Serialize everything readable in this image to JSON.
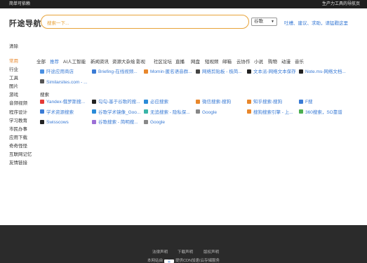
{
  "topbar": {
    "left_text": "简单可依赖",
    "right_text": "生产力工具的导航页"
  },
  "header": {
    "logo": "阡途导航",
    "search_placeholder": "搜索一下...",
    "engine": "谷歌",
    "feedback_link": "吐槽、建议、求助，请猛戳这里"
  },
  "clear_label": "清除",
  "sidebar": {
    "items": [
      {
        "label": "常用",
        "active": true
      },
      {
        "label": "行业"
      },
      {
        "label": "工具"
      },
      {
        "label": "图片"
      },
      {
        "label": "游戏"
      },
      {
        "label": "音频视频"
      },
      {
        "label": "程序设计"
      },
      {
        "label": "学习教育"
      },
      {
        "label": "市民办事"
      },
      {
        "label": "应用下载"
      },
      {
        "label": "奇奇怪怪"
      },
      {
        "label": "互联网记忆"
      },
      {
        "label": "友情链接"
      }
    ]
  },
  "tabs": [
    {
      "label": "全部"
    },
    {
      "label": "推荐",
      "active": true
    },
    {
      "label": "AI人工智能"
    },
    {
      "label": "新闻资讯"
    },
    {
      "label": "资源大杂烩"
    },
    {
      "label": "影视"
    },
    {
      "label": "社区论坛"
    },
    {
      "label": "直播"
    },
    {
      "label": "网盘"
    },
    {
      "label": "短视频"
    },
    {
      "label": "邮箱"
    },
    {
      "label": "云协作"
    },
    {
      "label": "小说"
    },
    {
      "label": "购物"
    },
    {
      "label": "动漫"
    },
    {
      "label": "音乐"
    }
  ],
  "recommended": [
    {
      "label": "阡途应用商店",
      "icon": "store-icon",
      "color": "#4a90e2"
    },
    {
      "label": "Briefing-在线视频...",
      "icon": "briefing-icon",
      "color": "#3a7bd5"
    },
    {
      "label": "Momin-匿名语音群...",
      "icon": "momin-icon",
      "color": "#e8872c"
    },
    {
      "label": "网络剪贴板 - 极简...",
      "icon": "clipboard-icon",
      "color": "#444444"
    },
    {
      "label": "文本派-网络文本保存",
      "icon": "text-icon",
      "color": "#222222"
    },
    {
      "label": "Note.ms-网络文档...",
      "icon": "note-icon",
      "color": "#222222"
    },
    {
      "label": "Similarsites.com - ...",
      "icon": "similarsites-icon",
      "color": "#555555"
    }
  ],
  "search_section": {
    "title": "搜索",
    "rows": [
      [
        {
          "label": "Yandex-俄罗斯搜...",
          "icon": "yandex-icon",
          "color": "#e53935"
        },
        {
          "label": "勾勾-基于谷歌的搜...",
          "icon": "gougou-icon",
          "color": "#222222"
        },
        {
          "label": "必应搜索",
          "icon": "bing-icon",
          "color": "#2a8bd8"
        },
        {
          "label": "微信搜索-搜狗",
          "icon": "wechat-search-icon",
          "color": "#e8872c"
        },
        {
          "label": "知乎搜索-搜狗",
          "icon": "zhihu-search-icon",
          "color": "#e8872c"
        },
        {
          "label": "F搜",
          "icon": "fsou-icon",
          "color": "#3a7bd5"
        }
      ],
      [
        {
          "label": "学术资源搜索",
          "icon": "academic-icon",
          "color": "#3a7bd5"
        },
        {
          "label": "谷歌学术镜像_Goo...",
          "icon": "scholar-icon",
          "color": "#2a8bd8"
        },
        {
          "label": "无追搜索 - 隐私保...",
          "icon": "wuzhui-icon",
          "color": "#3ab5a8"
        },
        {
          "label": "Google",
          "icon": "google-icon",
          "color": "#888888"
        },
        {
          "label": "搜狗搜索引擎 - 上...",
          "icon": "sogou-icon",
          "color": "#e8872c"
        },
        {
          "label": "360搜索，SO靠谱",
          "icon": "so360-icon",
          "color": "#4caf50"
        }
      ],
      [
        {
          "label": "Swisscows",
          "icon": "swisscows-icon",
          "color": "#222222"
        },
        {
          "label": "谷歌搜索 - 简明搜...",
          "icon": "google-simple-icon",
          "color": "#9c6fd6"
        },
        {
          "label": "Google",
          "icon": "google-icon",
          "color": "#888888"
        }
      ]
    ]
  },
  "footer": {
    "links": [
      "法律声明",
      "下载声明",
      "版权声明"
    ],
    "line2_prefix": "本网站由",
    "badge": "云",
    "line2_suffix": "提供CDN加速/云存储服务"
  }
}
